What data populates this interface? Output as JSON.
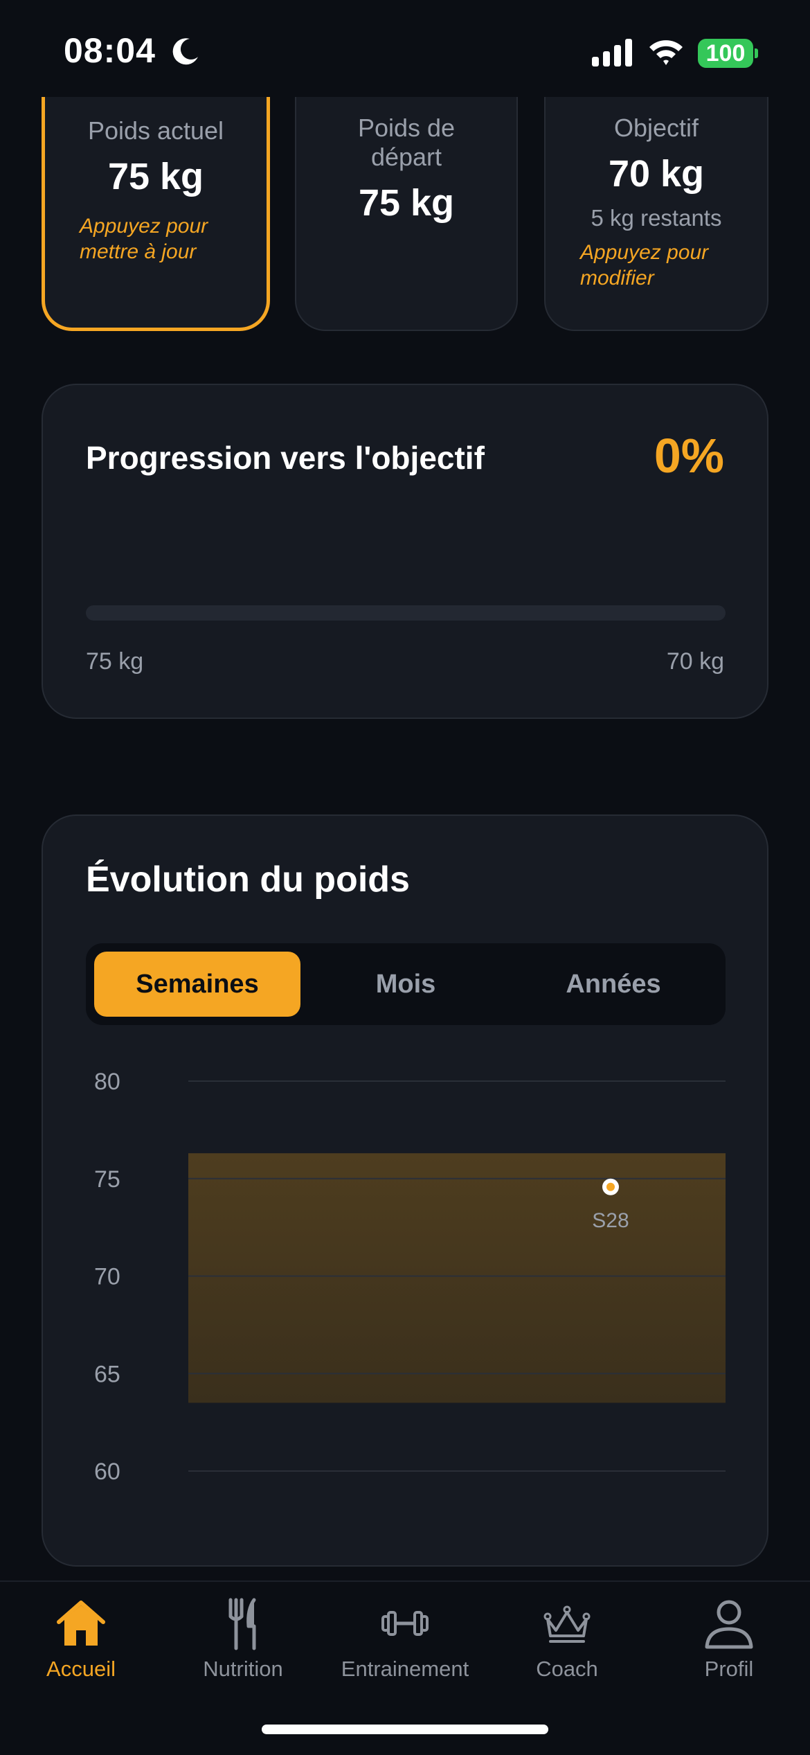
{
  "status_bar": {
    "time": "08:04",
    "battery": "100"
  },
  "stats": {
    "current": {
      "label": "Poids actuel",
      "value": "75 kg",
      "hint": "Appuyez pour mettre à jour"
    },
    "start": {
      "label": "Poids de départ",
      "value": "75 kg"
    },
    "goal": {
      "label": "Objectif",
      "value": "70 kg",
      "remaining": "5 kg restants",
      "hint": "Appuyez pour modifier"
    }
  },
  "progress": {
    "title": "Progression vers l'objectif",
    "percent_text": "0%",
    "percent": 0,
    "start_label": "75 kg",
    "end_label": "70 kg"
  },
  "evolution": {
    "title": "Évolution du poids",
    "tabs": [
      "Semaines",
      "Mois",
      "Années"
    ],
    "selected_tab": "Semaines"
  },
  "chart_data": {
    "type": "scatter",
    "y_ticks": [
      "80",
      "75",
      "70",
      "65",
      "60"
    ],
    "ylim": [
      60,
      80
    ],
    "points": [
      {
        "label": "S28",
        "y": 75
      }
    ],
    "band": [
      63.5,
      76.3
    ],
    "colors": {
      "accent": "#f5a623",
      "band": "#4a3a1e"
    }
  },
  "nav": {
    "items": [
      {
        "label": "Accueil",
        "icon": "home-icon",
        "active": true
      },
      {
        "label": "Nutrition",
        "icon": "fork-knife-icon",
        "active": false
      },
      {
        "label": "Entrainement",
        "icon": "dumbbell-icon",
        "active": false
      },
      {
        "label": "Coach",
        "icon": "crown-icon",
        "active": false
      },
      {
        "label": "Profil",
        "icon": "person-icon",
        "active": false
      }
    ]
  },
  "colors": {
    "accent": "#f5a623",
    "background": "#0b0e14",
    "card": "#161a22",
    "muted": "#9aa0ab"
  }
}
